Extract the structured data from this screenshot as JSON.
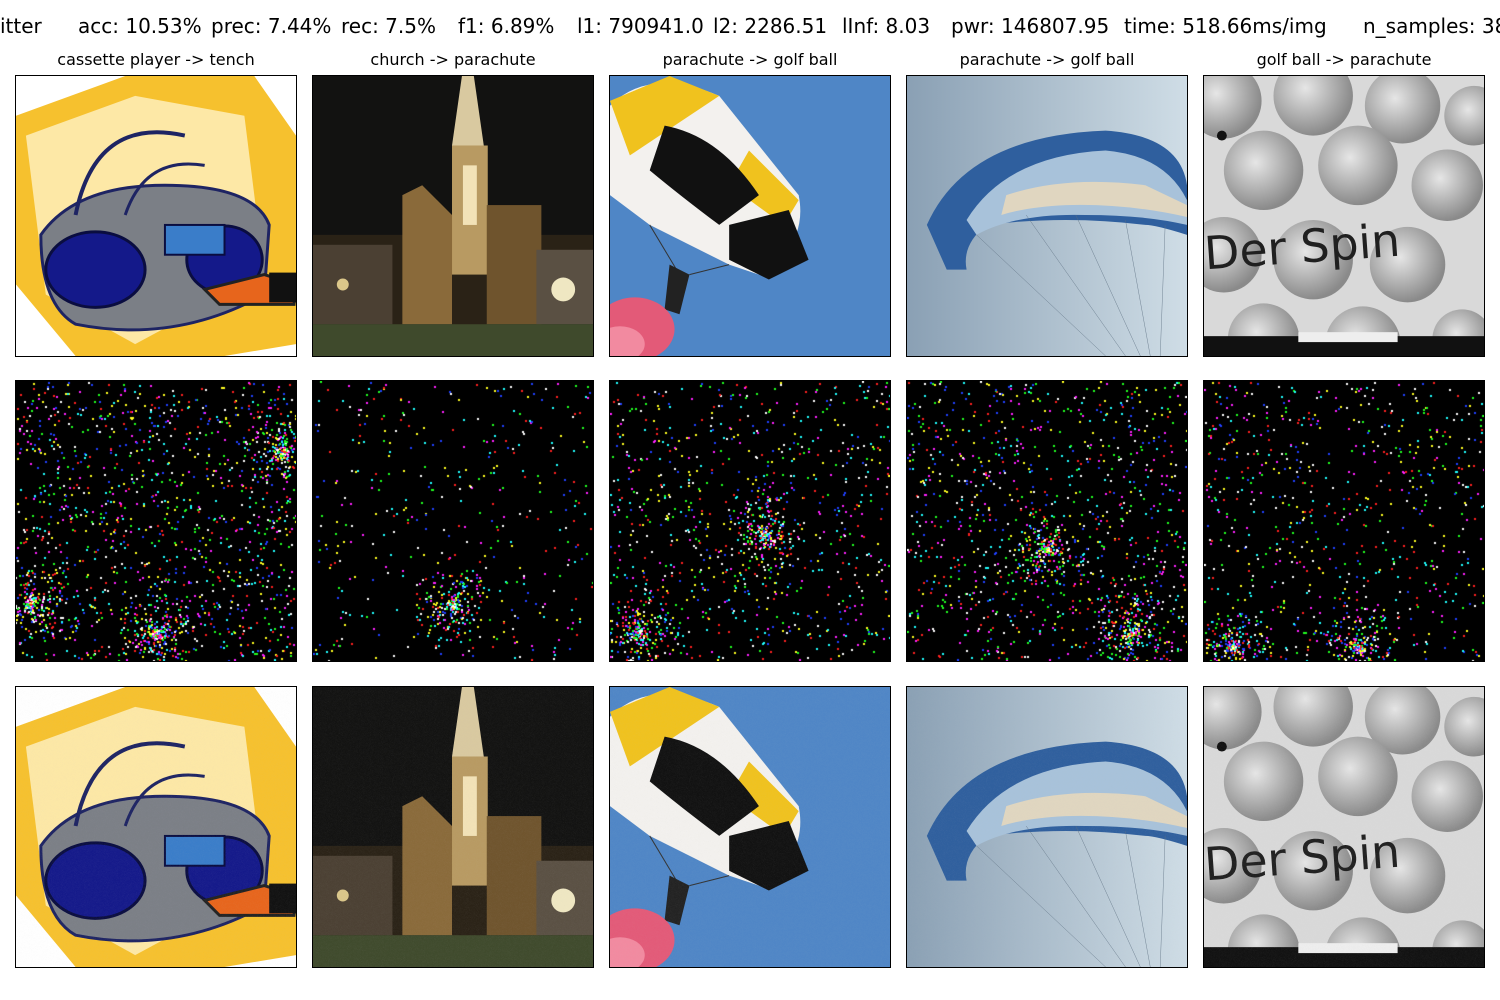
{
  "header": {
    "method": "itter",
    "accuracy": "acc: 10.53%",
    "precision": "prec: 7.44%",
    "recall": "rec: 7.5%",
    "f1": "f1: 6.89%",
    "l1": "l1: 790941.0",
    "l2": "l2: 2286.51",
    "linf": "lInf: 8.03",
    "power": "pwr: 146807.95",
    "time": "time: 518.66ms/img",
    "n_samples": "n_samples: 38"
  },
  "columns": [
    {
      "title": "cassette player -> tench",
      "subject": "boombox",
      "noise_density": 0.3,
      "noise_hotspots": [
        [
          0.05,
          0.8
        ],
        [
          0.95,
          0.25
        ],
        [
          0.5,
          0.9
        ]
      ]
    },
    {
      "title": "church -> parachute",
      "subject": "church",
      "noise_density": 0.1,
      "noise_hotspots": [
        [
          0.5,
          0.8
        ]
      ]
    },
    {
      "title": "parachute -> golf ball",
      "subject": "skydiver",
      "noise_density": 0.2,
      "noise_hotspots": [
        [
          0.55,
          0.55
        ],
        [
          0.1,
          0.9
        ]
      ]
    },
    {
      "title": "parachute -> golf ball",
      "subject": "paraglider",
      "noise_density": 0.25,
      "noise_hotspots": [
        [
          0.8,
          0.9
        ],
        [
          0.5,
          0.6
        ]
      ]
    },
    {
      "title": "golf ball -> parachute",
      "subject": "golfball",
      "noise_density": 0.18,
      "noise_hotspots": [
        [
          0.1,
          0.95
        ],
        [
          0.55,
          0.95
        ]
      ]
    }
  ],
  "rows": [
    "original",
    "perturbation",
    "adversarial"
  ]
}
